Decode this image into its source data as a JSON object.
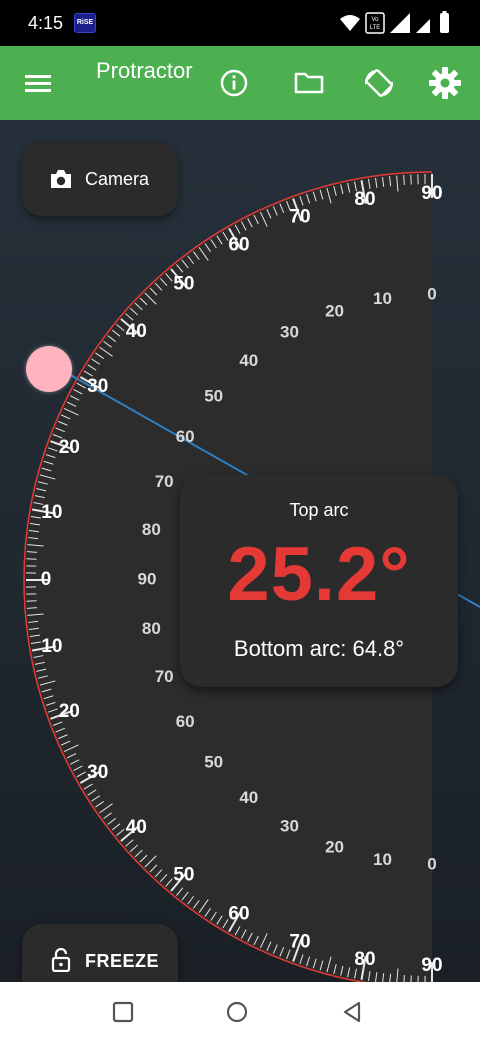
{
  "status_bar": {
    "time": "4:15",
    "carrier_badge": "RiSE",
    "icons": [
      "wifi-icon",
      "volte-icon",
      "signal-icon",
      "battery-icon"
    ]
  },
  "app_bar": {
    "title": "Protractor",
    "background": "#4caf50",
    "icons": [
      "menu-icon",
      "info-icon",
      "folder-icon",
      "screen-rotation-icon",
      "settings-icon"
    ]
  },
  "camera_button": {
    "label": "Camera",
    "icon": "camera-icon"
  },
  "freeze_button": {
    "label": "FREEZE",
    "icon": "lock-open-icon"
  },
  "protractor": {
    "outer_scale_labels": [
      "90",
      "80",
      "70",
      "60",
      "50",
      "40",
      "30",
      "20",
      "10",
      "0",
      "10",
      "20",
      "30",
      "40",
      "50",
      "60",
      "70",
      "80",
      "90"
    ],
    "inner_scale_labels": [
      "0",
      "10",
      "20",
      "30",
      "40",
      "50",
      "60",
      "70",
      "80",
      "90",
      "80",
      "70",
      "60",
      "50",
      "40",
      "30",
      "20",
      "10",
      "0"
    ],
    "measured_angle_deg": 25.2,
    "arc_color": "#e53935",
    "line_color": "#2f7fc1"
  },
  "readout": {
    "label": "Top arc",
    "value": "25.2°",
    "bottom": "Bottom arc: 64.8°",
    "value_color": "#e53935"
  },
  "nav_bar": {
    "buttons": [
      "recents-button",
      "home-button",
      "back-button"
    ]
  }
}
